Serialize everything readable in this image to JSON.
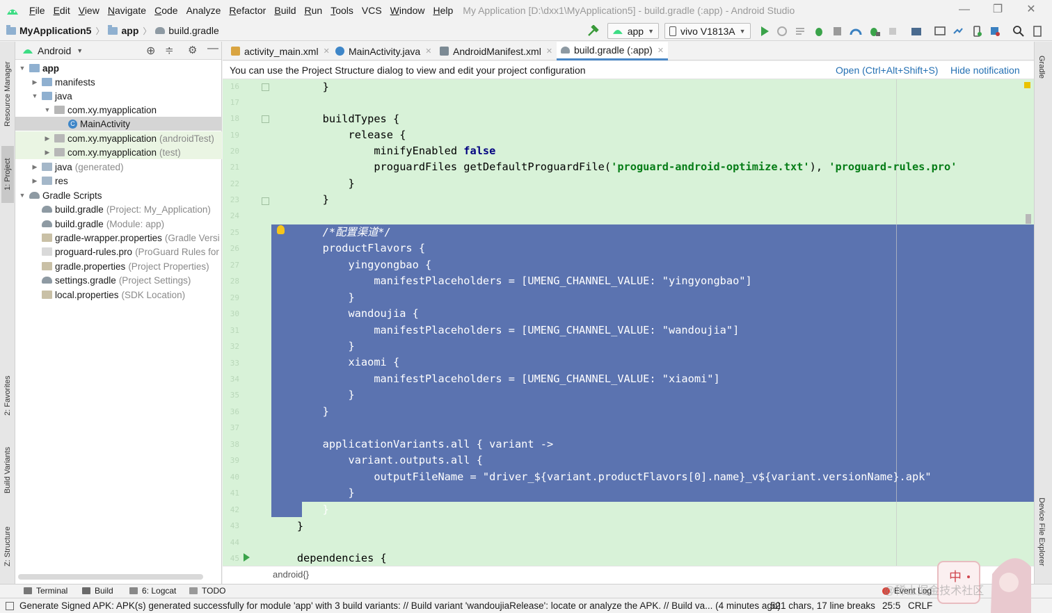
{
  "menubar": {
    "items": [
      {
        "label": "File",
        "u": "F",
        "rest": "ile"
      },
      {
        "label": "Edit",
        "u": "E",
        "rest": "dit"
      },
      {
        "label": "View",
        "u": "V",
        "rest": "iew"
      },
      {
        "label": "Navigate",
        "u": "N",
        "rest": "avigate"
      },
      {
        "label": "Code",
        "u": "C",
        "rest": "ode"
      },
      {
        "label": "Analyze",
        "u": "",
        "rest": "Analyze"
      },
      {
        "label": "Refactor",
        "u": "R",
        "rest": "efactor"
      },
      {
        "label": "Build",
        "u": "B",
        "rest": "uild"
      },
      {
        "label": "Run",
        "u": "R",
        "rest": "un"
      },
      {
        "label": "Tools",
        "u": "T",
        "rest": "ools"
      },
      {
        "label": "VCS",
        "u": "",
        "rest": "VCS"
      },
      {
        "label": "Window",
        "u": "W",
        "rest": "indow"
      },
      {
        "label": "Help",
        "u": "H",
        "rest": "elp"
      }
    ],
    "window_title": "My Application [D:\\dxx1\\MyApplication5] - build.gradle (:app) - Android Studio"
  },
  "navbar": {
    "project": "MyApplication5",
    "module": "app",
    "file": "build.gradle",
    "run_config": "app",
    "device": "vivo V1813A"
  },
  "left_stripe": {
    "resource_manager": "Resource Manager",
    "project": "1: Project",
    "favorites": "2: Favorites",
    "build_variants": "Build Variants",
    "structure": "Z: Structure"
  },
  "right_stripe": {
    "gradle": "Gradle",
    "device_file_explorer": "Device File Explorer"
  },
  "project_panel": {
    "view_mode": "Android",
    "tree": [
      {
        "label": "app",
        "hint": "",
        "bold": true
      },
      {
        "label": "manifests",
        "hint": ""
      },
      {
        "label": "java",
        "hint": ""
      },
      {
        "label": "com.xy.myapplication",
        "hint": ""
      },
      {
        "label": "MainActivity",
        "hint": ""
      },
      {
        "label": "com.xy.myapplication",
        "hint": "(androidTest)"
      },
      {
        "label": "com.xy.myapplication",
        "hint": "(test)"
      },
      {
        "label": "java",
        "hint": "(generated)"
      },
      {
        "label": "res",
        "hint": ""
      },
      {
        "label": "Gradle Scripts",
        "hint": ""
      },
      {
        "label": "build.gradle",
        "hint": "(Project: My_Application)"
      },
      {
        "label": "build.gradle",
        "hint": "(Module: app)"
      },
      {
        "label": "gradle-wrapper.properties",
        "hint": "(Gradle Versi"
      },
      {
        "label": "proguard-rules.pro",
        "hint": "(ProGuard Rules for"
      },
      {
        "label": "gradle.properties",
        "hint": "(Project Properties)"
      },
      {
        "label": "settings.gradle",
        "hint": "(Project Settings)"
      },
      {
        "label": "local.properties",
        "hint": "(SDK Location)"
      }
    ]
  },
  "editor_tabs": [
    {
      "label": "activity_main.xml",
      "active": false
    },
    {
      "label": "MainActivity.java",
      "active": false
    },
    {
      "label": "AndroidManifest.xml",
      "active": false
    },
    {
      "label": "build.gradle (:app)",
      "active": true
    }
  ],
  "notification": {
    "text": "You can use the Project Structure dialog to view and edit your project configuration",
    "open_link": "Open (Ctrl+Alt+Shift+S)",
    "hide_link": "Hide notification"
  },
  "editor": {
    "line_numbers": [
      "16",
      "17",
      "18",
      "19",
      "20",
      "21",
      "22",
      "23",
      "24",
      "25",
      "26",
      "27",
      "28",
      "29",
      "30",
      "31",
      "32",
      "33",
      "34",
      "35",
      "36",
      "37",
      "38",
      "39",
      "40",
      "41",
      "42",
      "43",
      "44",
      "45"
    ],
    "lines": {
      "l16": "        }",
      "l18": "        buildTypes {",
      "l19": "            release {",
      "l20_a": "                minifyEnabled ",
      "l20_b": "false",
      "l21_a": "                proguardFiles getDefaultProguardFile(",
      "l21_b": "'proguard-android-optimize.txt'",
      "l21_c": "), ",
      "l21_d": "'proguard-rules.pro'",
      "l22": "            }",
      "l23": "        }",
      "l25": "        /*配置渠道*/",
      "l26": "        productFlavors {",
      "l27": "            yingyongbao {",
      "l28": "                manifestPlaceholders = [UMENG_CHANNEL_VALUE: \"yingyongbao\"]",
      "l29": "            }",
      "l30": "            wandoujia {",
      "l31": "                manifestPlaceholders = [UMENG_CHANNEL_VALUE: \"wandoujia\"]",
      "l32": "            }",
      "l33": "            xiaomi {",
      "l34": "                manifestPlaceholders = [UMENG_CHANNEL_VALUE: \"xiaomi\"]",
      "l35": "            }",
      "l36": "        }",
      "l38": "        applicationVariants.all { variant ->",
      "l39": "            variant.outputs.all {",
      "l40": "                outputFileName = \"driver_${variant.productFlavors[0].name}_v${variant.versionName}.apk\"",
      "l41": "            }",
      "l42": "        }",
      "l43": "    }",
      "l45": "    dependencies {"
    },
    "breadcrumb": "android{}"
  },
  "tool_windows": {
    "terminal": "Terminal",
    "build": "Build",
    "logcat": "6: Logcat",
    "todo": "TODO",
    "event_log": "Event Log"
  },
  "status": {
    "message": "Generate Signed APK: APK(s) generated successfully for module 'app' with 3 build variants: // Build variant 'wandoujiaRelease': locate or analyze the APK. // Build va... (4 minutes ago)",
    "chars": "521 chars, 17 line breaks",
    "position": "25:5",
    "line_sep": "CRLF"
  },
  "watermark": "@稀土掘金技术社区",
  "colors": {
    "editor_bg": "#d8f2d8",
    "selection": "#5b73b0",
    "link": "#2470b3",
    "android_green": "#3ddc84"
  }
}
